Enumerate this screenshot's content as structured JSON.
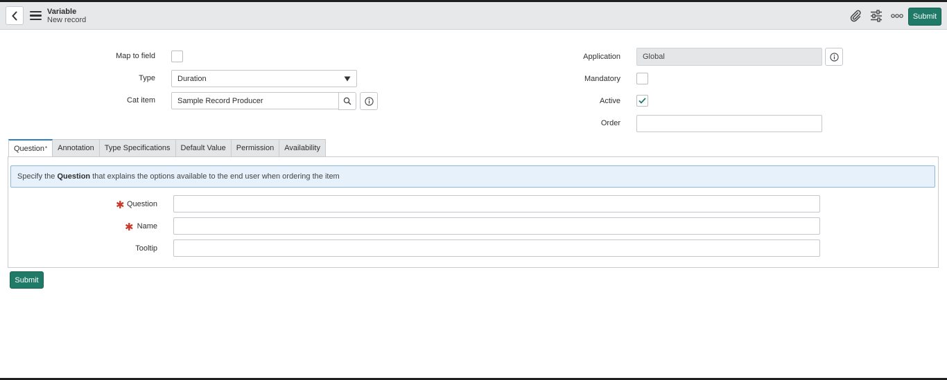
{
  "header": {
    "title": "Variable",
    "subtitle": "New record",
    "submit_label": "Submit",
    "icons": [
      "chevron-left-icon",
      "hamburger-menu-icon",
      "paperclip-icon",
      "settings-sliders-icon",
      "more-options-icon"
    ]
  },
  "form": {
    "map_to_field": {
      "label": "Map to field",
      "checked": false
    },
    "type": {
      "label": "Type",
      "value": "Duration"
    },
    "cat_item": {
      "label": "Cat item",
      "value": "Sample Record Producer"
    },
    "application": {
      "label": "Application",
      "value": "Global"
    },
    "mandatory": {
      "label": "Mandatory",
      "checked": false
    },
    "active": {
      "label": "Active",
      "checked": true
    },
    "order": {
      "label": "Order",
      "value": ""
    }
  },
  "tabs": [
    {
      "label": "Question",
      "marker": "*",
      "active": true
    },
    {
      "label": "Annotation"
    },
    {
      "label": "Type Specifications"
    },
    {
      "label": "Default Value"
    },
    {
      "label": "Permission"
    },
    {
      "label": "Availability"
    }
  ],
  "question_tab": {
    "notice_prefix": "Specify the",
    "notice_bold": "Question",
    "notice_suffix": "that explains the options available to the end user when ordering the item",
    "question": {
      "label": "Question",
      "value": "",
      "required": true
    },
    "name": {
      "label": "Name",
      "value": "",
      "required": true
    },
    "tooltip": {
      "label": "Tooltip",
      "value": ""
    }
  },
  "footer": {
    "submit_label": "Submit"
  },
  "colors": {
    "accent": "#1f7a68",
    "tab_active": "#2f7fbf",
    "required": "#c73a2a",
    "notice_bg": "#e6f1fb"
  }
}
